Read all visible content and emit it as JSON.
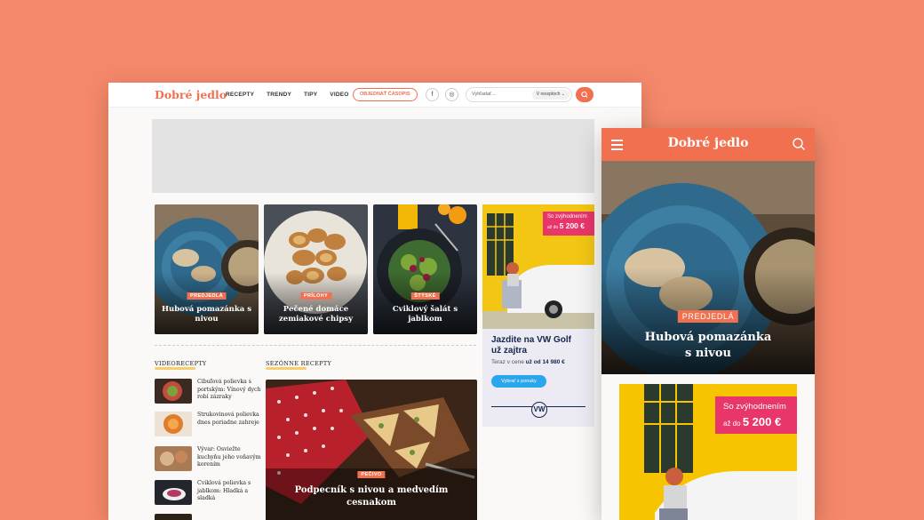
{
  "desktop": {
    "logo": "Dobré jedlo",
    "nav": [
      "RECEPTY",
      "TRENDY",
      "TIPY",
      "VIDEO"
    ],
    "subscribe_label": "OBJEDNAŤ ČASOPIS",
    "social": {
      "facebook": "f",
      "instagram": "◎"
    },
    "search": {
      "placeholder": "Vyhľadať...",
      "scope": "V receptoch ⌄"
    },
    "cards": [
      {
        "badge": "PREDJEDLÁ",
        "title": "Hubová pomazánka s nivou"
      },
      {
        "badge": "PRÍLOHY",
        "title": "Pečené domáce zemiakové chipsy"
      },
      {
        "badge": "ŠTÝSKÉ",
        "title": "Cviklový šalát s jablkom"
      }
    ],
    "sections": {
      "video": "VIDEORECEPTY",
      "seasonal": "SEZÓNNE RECEPTY"
    },
    "video_recipes": [
      "Cibuľová polievka s portským: Vínový dych robí zázraky",
      "Strukovinová polievka dnes poriadne zahreje",
      "Vývar: Osviežte kuchyňu jeho voňavým korením",
      "Cviklová polievka s jablkom: Hladká a sladká"
    ],
    "seasonal": {
      "badge": "PEČIVO",
      "title": "Podpecník s nivou a medvedím cesnakom"
    },
    "vw_ad": {
      "promo_line1": "So zvýhodnením",
      "promo_prefix": "až do",
      "promo_amount": "5 200 €",
      "headline": "Jazdite na VW Golf už zajtra",
      "price_prefix": "Teraz v cene",
      "price_value": "už od 14 980 €",
      "button": "Vybrať z ponuky",
      "logo": "VW"
    }
  },
  "mobile": {
    "logo": "Dobré jedlo",
    "hero": {
      "badge": "PREDJEDLÁ",
      "title": "Hubová pomazánka s nivou"
    },
    "ad": {
      "promo_line1": "So zvýhodnením",
      "promo_prefix": "až do",
      "promo_amount": "5 200 €"
    }
  },
  "colors": {
    "background": "#f5886a",
    "accent": "#f0704f",
    "promo": "#e8366a",
    "vw_navy": "#14254f",
    "button_blue": "#2aa6ec"
  }
}
